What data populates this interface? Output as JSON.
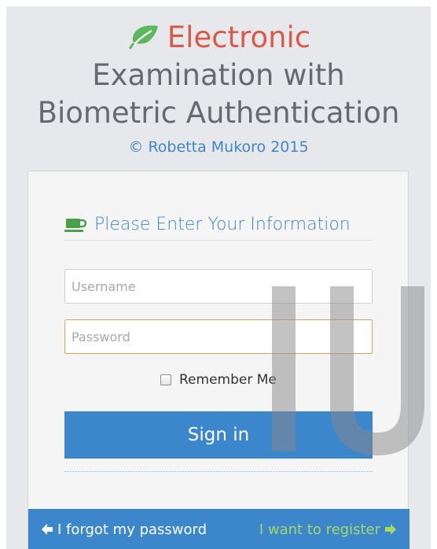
{
  "header": {
    "brand_word": "Electronic",
    "subtitle_line1": "Examination with",
    "subtitle_line2": "Biometric Authentication",
    "copyright": "© Robetta Mukoro 2015",
    "brand_icon": "leaf-icon",
    "brand_color": "#d95a47",
    "leaf_color": "#5cb85c"
  },
  "login": {
    "heading_icon": "coffee-cup-icon",
    "heading": "Please Enter Your Information",
    "username": {
      "value": "",
      "placeholder": "Username"
    },
    "password": {
      "value": "",
      "placeholder": "Password"
    },
    "remember_label": "Remember Me",
    "remember_checked": false,
    "signin_label": "Sign in"
  },
  "footer": {
    "forgot_label": "I forgot my password",
    "forgot_icon": "arrow-left-icon",
    "register_label": "I want to register",
    "register_icon": "arrow-right-icon"
  },
  "colors": {
    "primary": "#3c87cc",
    "register_link": "#a6d860",
    "focus_border": "#e8a25e"
  }
}
